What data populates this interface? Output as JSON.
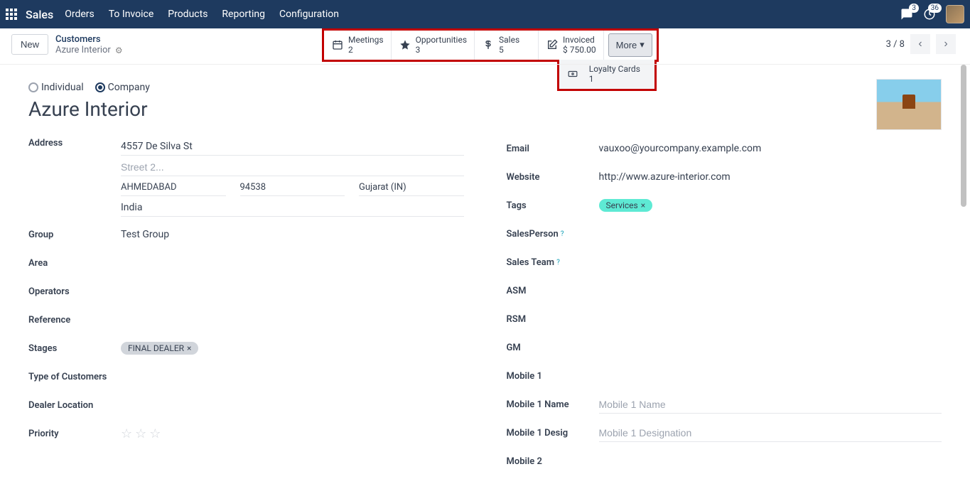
{
  "nav": {
    "brand": "Sales",
    "items": [
      "Orders",
      "To Invoice",
      "Products",
      "Reporting",
      "Configuration"
    ],
    "msg_badge": "3",
    "clock_badge": "36"
  },
  "control": {
    "new": "New",
    "bc_top": "Customers",
    "bc_bottom": "Azure Interior",
    "counter": "3 / 8"
  },
  "stats": {
    "meetings": {
      "label": "Meetings",
      "value": "2"
    },
    "opportunities": {
      "label": "Opportunities",
      "value": "3"
    },
    "sales": {
      "label": "Sales",
      "value": "5"
    },
    "invoiced": {
      "label": "Invoiced",
      "value": "$ 750.00"
    },
    "more": "More",
    "loyalty": {
      "label": "Loyalty Cards",
      "value": "1"
    }
  },
  "form": {
    "individual": "Individual",
    "company": "Company",
    "name": "Azure Interior",
    "left": {
      "address_label": "Address",
      "street1": "4557 De Silva St",
      "street2_ph": "Street 2...",
      "city": "AHMEDABAD",
      "zip": "94538",
      "state": "Gujarat (IN)",
      "country": "India",
      "group_label": "Group",
      "group_val": "Test Group",
      "area_label": "Area",
      "operators_label": "Operators",
      "reference_label": "Reference",
      "stages_label": "Stages",
      "stages_val": "FINAL DEALER",
      "type_cust_label": "Type of Customers",
      "dealer_loc_label": "Dealer Location",
      "priority_label": "Priority"
    },
    "right": {
      "email_label": "Email",
      "email_val": "vauxoo@yourcompany.example.com",
      "website_label": "Website",
      "website_val": "http://www.azure-interior.com",
      "tags_label": "Tags",
      "tags_val": "Services",
      "salesperson_label": "SalesPerson",
      "salesteam_label": "Sales Team",
      "asm_label": "ASM",
      "rsm_label": "RSM",
      "gm_label": "GM",
      "mobile1_label": "Mobile 1",
      "mobile1name_label": "Mobile 1 Name",
      "mobile1name_ph": "Mobile 1 Name",
      "mobile1desig_label": "Mobile 1 Desig",
      "mobile1desig_ph": "Mobile 1 Designation",
      "mobile2_label": "Mobile 2"
    }
  }
}
